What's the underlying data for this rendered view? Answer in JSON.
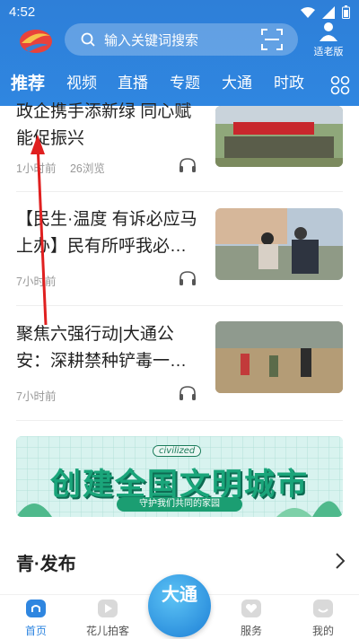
{
  "status": {
    "time": "4:52"
  },
  "search": {
    "placeholder": "输入关键词搜索"
  },
  "elder_mode": {
    "label": "适老版"
  },
  "tabs": [
    "推荐",
    "视频",
    "直播",
    "专题",
    "大通",
    "时政"
  ],
  "news": [
    {
      "title": "政企携手添新绿 同心赋能促振兴",
      "time": "1小时前",
      "views": "26浏览"
    },
    {
      "title": "【民生·温度 有诉必应马上办】民有所呼我必…",
      "time": "7小时前",
      "views": ""
    },
    {
      "title": "聚焦六强行动|大通公安：深耕禁种铲毒一…",
      "time": "7小时前",
      "views": ""
    }
  ],
  "banner": {
    "tag": "civilized",
    "headline": "创建全国文明城市",
    "sub": "守护我们共同的家园"
  },
  "section": {
    "title": "青·发布"
  },
  "bottom_nav": {
    "items": [
      "首页",
      "花儿拍客",
      "服务",
      "我的"
    ],
    "center": "大通"
  },
  "colors": {
    "brand_blue": "#2f86e0",
    "arrow_red": "#e02020"
  }
}
